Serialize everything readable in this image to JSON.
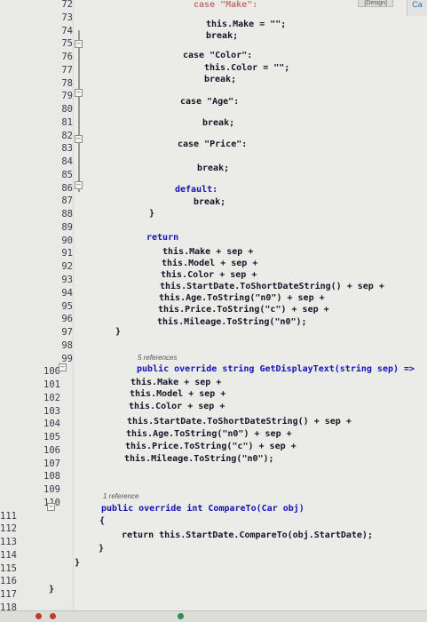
{
  "window": {
    "tab_label": "[Design]",
    "corner_label": "Ca"
  },
  "gutter": {
    "line_numbers": [
      "72",
      "73",
      "74",
      "75",
      "76",
      "77",
      "78",
      "79",
      "80",
      "81",
      "82",
      "83",
      "84",
      "85",
      "86",
      "87",
      "88",
      "89",
      "90",
      "91",
      "92",
      "93",
      "94",
      "95",
      "96",
      "97",
      "98",
      "99",
      "100",
      "101",
      "102",
      "103",
      "104",
      "105",
      "106",
      "107",
      "108",
      "109",
      "110",
      "111",
      "112",
      "113",
      "114",
      "115",
      "116",
      "117",
      "118"
    ]
  },
  "code": {
    "case_make_partial": "case \"Make\":",
    "make_assign": "this.Make = \"\";",
    "break_1": "break;",
    "case_color": "case \"Color\":",
    "color_assign": "this.Color = \"\";",
    "break_2": "break;",
    "case_age": "case \"Age\":",
    "break_3": "break;",
    "case_price": "case \"Price\":",
    "break_4": "break;",
    "default_label": "default:",
    "break_5": "break;",
    "close_switch": "}",
    "return_kw": "return",
    "ret_make": "this.Make + sep +",
    "ret_model": "this.Model + sep +",
    "ret_color": "this.Color + sep +",
    "ret_startdate": "this.StartDate.ToShortDateString() + sep +",
    "ret_age": "this.Age.ToString(\"n0\") + sep +",
    "ret_price": "this.Price.ToString(\"c\") + sep +",
    "ret_mileage": "this.Mileage.ToString(\"n0\");",
    "close_method_1": "}",
    "refs_1": "5 references",
    "sig_display": "public override string GetDisplayText(string sep) =>",
    "disp_make": "this.Make + sep +",
    "disp_model": "this.Model + sep +",
    "disp_color": "this.Color + sep +",
    "disp_startdate": "this.StartDate.ToShortDateString() + sep +",
    "disp_age": "this.Age.ToString(\"n0\") + sep +",
    "disp_price": "this.Price.ToString(\"c\") + sep +",
    "disp_mileage": "this.Mileage.ToString(\"n0\");",
    "refs_2": "1 reference",
    "sig_compare": "public override int CompareTo(Car obj)",
    "open_brace": "{",
    "compare_return": "return this.StartDate.CompareTo(obj.StartDate);",
    "close_compare": "}",
    "close_class": "}",
    "close_namespace": "}"
  }
}
